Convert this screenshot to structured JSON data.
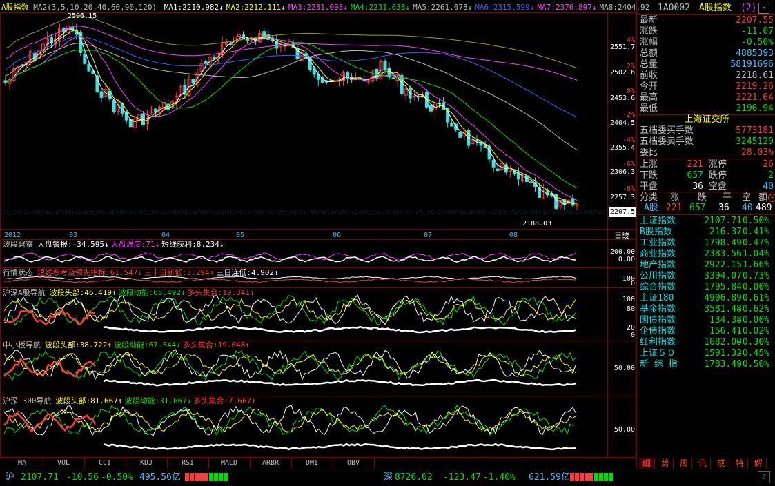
{
  "main_chart": {
    "title": "A股指数",
    "ma_header": "MA2(3,5,10,20,40,60,90,120)",
    "ma_values": [
      {
        "label": "MA1:2210.982",
        "arrow": "↓",
        "color": "#ffffff"
      },
      {
        "label": "MA2:2212.111",
        "arrow": "↓",
        "color": "#ffff00"
      },
      {
        "label": "MA3:2231.093",
        "arrow": "↓",
        "color": "#ff40ff"
      },
      {
        "label": "MA4:2231.638",
        "arrow": "↓",
        "color": "#00e000"
      },
      {
        "label": "MA5:2261.078",
        "arrow": "↓",
        "color": "#c0c0c0"
      },
      {
        "label": "MA6:2315.599",
        "arrow": "↓",
        "color": "#4060ff"
      },
      {
        "label": "MA7:2376.897",
        "arrow": "↓",
        "color": "#ff40ff"
      },
      {
        "label": "MA8:2404.92",
        "arrow": "",
        "color": "#c0c0c0"
      }
    ],
    "high_label": "2596.15",
    "low_label": "2188.03",
    "current_price_tag": "2207.5",
    "price_axis": [
      "2551.7",
      "2502.6",
      "2453.6",
      "2404.5",
      "2355.4",
      "2306.3",
      "2257.3"
    ],
    "pct_axis": [
      "4%",
      "2%",
      "0%",
      "-2%",
      "-4%",
      "-6%",
      "-8%"
    ],
    "months": [
      "2012",
      "03",
      "04",
      "05",
      "06",
      "07",
      "08"
    ],
    "period": "日线"
  },
  "panels": [
    {
      "name": "波段窘察",
      "items": [
        {
          "text": "大盘警报:-34.595",
          "arrow": "↓",
          "color": "#ffffff"
        },
        {
          "text": "大盘温度:71",
          "arrow": "↓",
          "color": "#ff40ff"
        },
        {
          "text": "短线获利:8.234",
          "arrow": "↓",
          "color": "#ffffff"
        }
      ],
      "axis": [
        "200.00",
        "0.00"
      ]
    },
    {
      "name": "行情状态",
      "items": [
        {
          "text": "短线参考及领先指标:61.547",
          "arrow": "↓",
          "color": "#ff3c3c"
        },
        {
          "text": "三十日新低:3.294",
          "arrow": "↑",
          "color": "#ff3c3c"
        },
        {
          "text": "三日连低:4.902",
          "arrow": "↑",
          "color": "#ffffff"
        }
      ],
      "axis": [
        "100",
        "0"
      ]
    },
    {
      "name": "沪深A股导航",
      "items": [
        {
          "text": "波段头部:46.419",
          "arrow": "↑",
          "color": "#ffff00"
        },
        {
          "text": "波段动能:65.492",
          "arrow": "↓",
          "color": "#00e000"
        },
        {
          "text": "多头集合:19.341",
          "arrow": "↑",
          "color": "#ff3c3c"
        }
      ],
      "axis": [
        "100",
        "80",
        "20",
        "0"
      ]
    },
    {
      "name": "中小板导航",
      "items": [
        {
          "text": "波段头部:38.722",
          "arrow": "↑",
          "color": "#ffff00"
        },
        {
          "text": "波段动能:67.544",
          "arrow": "↓",
          "color": "#00e000"
        },
        {
          "text": "多头集合:19.048",
          "arrow": "↑",
          "color": "#ff3c3c"
        }
      ],
      "axis": [
        "50.00"
      ]
    },
    {
      "name": "沪深 300导航",
      "items": [
        {
          "text": "波段头部:81.667",
          "arrow": "↑",
          "color": "#ffff00"
        },
        {
          "text": "波段动能:31.667",
          "arrow": "↓",
          "color": "#00e000"
        },
        {
          "text": "多头集合:7.667",
          "arrow": "↑",
          "color": "#ff3c3c"
        }
      ],
      "axis": [
        "50.00"
      ]
    }
  ],
  "bottom_tabs": [
    "MA",
    "VOL",
    "CCI",
    "KDJ",
    "RSI",
    "MACD",
    "ARBR",
    "DMI",
    "OBV"
  ],
  "sidebar": {
    "code": "1A0002",
    "name": "A股指数",
    "badge": "(2)",
    "quote": [
      {
        "label": "最新",
        "value": "2207.55",
        "color": "#ff3c3c"
      },
      {
        "label": "涨跌",
        "value": "-11.07",
        "color": "#00e000"
      },
      {
        "label": "涨幅",
        "value": "-0.50%",
        "color": "#00e000"
      },
      {
        "label": "总额",
        "value": "4885393",
        "color": "#40c0ff"
      },
      {
        "label": "总量",
        "value": "58191696",
        "color": "#40c0ff"
      },
      {
        "label": "前收",
        "value": "2218.61",
        "color": "#c0c0c0"
      },
      {
        "label": "今开",
        "value": "2219.26",
        "color": "#ff3c3c"
      },
      {
        "label": "最高",
        "value": "2221.64",
        "color": "#ff3c3c"
      },
      {
        "label": "最低",
        "value": "2196.94",
        "color": "#00e000"
      }
    ],
    "exchange": "上海证交所",
    "orders": [
      {
        "label": "五档委买手数",
        "value": "5773181",
        "color": "#ff3c3c"
      },
      {
        "label": "五档委卖手数",
        "value": "3245129",
        "color": "#00e000"
      },
      {
        "label": "委比",
        "value": "28.03%",
        "color": "#ff3c3c"
      }
    ],
    "breadth": [
      {
        "l1": "上涨",
        "v1": "221",
        "c1": "#ff3c3c",
        "l2": "涨停",
        "v2": "26",
        "c2": "#ff3c3c"
      },
      {
        "l1": "下跌",
        "v1": "657",
        "c1": "#00e000",
        "l2": "跌停",
        "v2": "2",
        "c2": "#00e000"
      },
      {
        "l1": "平盘",
        "v1": "36",
        "c1": "#ffffff",
        "l2": "空盘",
        "v2": "40",
        "c2": "#40c0ff"
      }
    ],
    "class_header": [
      "分类",
      "涨",
      "跌",
      "平",
      "空",
      "额"
    ],
    "class_row": {
      "name": "A股",
      "up": "221",
      "down": "657",
      "flat": "36",
      "empty": "40",
      "amount": "489"
    },
    "indices": [
      {
        "name": "上证指数",
        "value": "2107.71",
        "pct": "-0.50%"
      },
      {
        "name": "B股指数",
        "value": "216.37",
        "pct": "-0.41%"
      },
      {
        "name": "工业指数",
        "value": "1798.49",
        "pct": "-0.47%"
      },
      {
        "name": "商业指数",
        "value": "2383.56",
        "pct": "-1.04%"
      },
      {
        "name": "地产指数",
        "value": "2922.15",
        "pct": "-1.66%"
      },
      {
        "name": "公用指数",
        "value": "3394.07",
        "pct": "-0.73%"
      },
      {
        "name": "综合指数",
        "value": "1795.84",
        "pct": "-0.00%"
      },
      {
        "name": "上证180",
        "value": "4906.89",
        "pct": "-0.61%"
      },
      {
        "name": "基金指数",
        "value": "3581.48",
        "pct": "-0.62%"
      },
      {
        "name": "国债指数",
        "value": "134.38",
        "pct": "-0.00%"
      },
      {
        "name": "企债指数",
        "value": "156.41",
        "pct": "-0.02%"
      },
      {
        "name": "红利指数",
        "value": "1682.00",
        "pct": "-0.30%"
      },
      {
        "name": "上证５０",
        "value": "1591.33",
        "pct": "-0.45%"
      },
      {
        "name": "新 综 指",
        "value": "1783.49",
        "pct": "-0.50%"
      }
    ],
    "tabs": [
      "细",
      "势",
      "周",
      "讯",
      "成",
      "特",
      "解"
    ]
  },
  "status": {
    "sh_label": "沪",
    "sh_index": "2107.71",
    "sh_change": "-10.56",
    "sh_pct": "-0.50%",
    "sh_amount": "495.56亿",
    "sz_label": "深",
    "sz_index": "8726.02",
    "sz_change": "-123.47",
    "sz_pct": "-1.40%",
    "sz_amount": "621.59亿"
  }
}
